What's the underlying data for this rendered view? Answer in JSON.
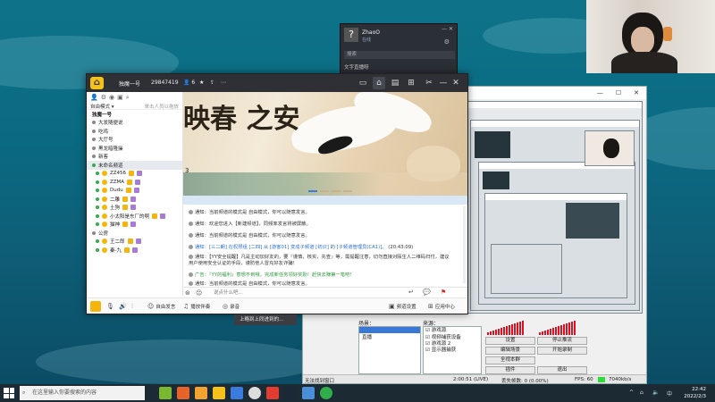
{
  "qq": {
    "avatar": "?",
    "name": "ZhaoO",
    "sub": "在线",
    "search": "搜索",
    "note": "文字直播呀"
  },
  "yy": {
    "channel_name": "独魔一号",
    "channel_id": "29847419",
    "online_count": "6",
    "mode": "自由模式",
    "mode_hint": "单击人员以拖放",
    "banner_text": "映春 之安",
    "banner_corner": "3",
    "sidebar": {
      "channels": [
        {
          "label": "独魔一号"
        },
        {
          "label": "大发随便说"
        },
        {
          "label": "吃鸡"
        },
        {
          "label": "大厅号"
        },
        {
          "label": "黑龙暗隆操"
        },
        {
          "label": "新客"
        },
        {
          "label": "未命名频道",
          "selected": true
        }
      ],
      "users": [
        "ZZ456",
        "ZZMA",
        "Dudu",
        "二雕",
        "土狗",
        "小太阳是东厂的啊",
        "猫神"
      ],
      "group2_label": "公房",
      "users2": [
        "王二郎",
        "秦-九"
      ]
    },
    "chat": [
      {
        "type": "plain",
        "text": "通知：当前频道的模式是 自由模式，你可以随意发言。"
      },
      {
        "type": "plain",
        "text": "通知：欢迎您进入【新建频道】，同频率发言将被屏蔽。"
      },
      {
        "type": "plain",
        "text": "通知：当前频道的模式是 自由模式，你可以随意发言。"
      },
      {
        "type": "blue",
        "sys": "通知：[三二朗] 在权限组 [二四] 从 [游客01] 变成子频道 [初识] 的 [子频道管理员(CA1)]。",
        "tail": "(20:43:09)"
      },
      {
        "type": "plain",
        "text": "通知：【YY安全提醒】凡是主动加好友的，要『谨慎，核实，先查』等，需提醒注意，切勿直接对陌生人二维码扫付，建议用户使用安全认证的手段，谨防他人冒充好友诈骗！"
      },
      {
        "type": "green",
        "text": "广告：『YY的福利』意想不到哦，完成新任务领好奖励！赶快去赚第一笔吧！"
      },
      {
        "type": "plain",
        "text": "通知：当前频道的模式是 自由模式，你可以随意发言。"
      }
    ],
    "input_placeholder": "说点什么吧...",
    "bottom": {
      "voice_label": "自由发言",
      "music_label": "播放伴奏",
      "record_label": "录音",
      "settings_label": "频道设置",
      "apps_label": "应用中心"
    },
    "tooltip": "上略到上同进到的..."
  },
  "obs": {
    "scenes_label": "场景：",
    "scenes": [
      "直播"
    ],
    "sources_label": "来源：",
    "sources": [
      {
        "label": "游戏源",
        "checked": true
      },
      {
        "label": "视频捕获设备",
        "checked": true
      },
      {
        "label": "游戏源 2",
        "checked": true
      },
      {
        "label": "显示器捕获",
        "checked": true
      }
    ],
    "buttons": {
      "settings": "设置",
      "stop_stream": "停止推流",
      "edit_scene": "编辑场景",
      "start_record": "开始录制",
      "fullscreen": "全视本群",
      "plugins": "插件",
      "exit": "退出"
    },
    "status": {
      "left": "无法找到窗口",
      "time": "2:00:51 (LIVE)",
      "dropped": "丢失帧数: 0 (0.00%)",
      "fps": "FPS: 60",
      "bitrate": "7040kb/s"
    }
  },
  "taskbar": {
    "search_placeholder": "在这里输入你要搜索的内容",
    "time": "22:42",
    "date": "2022/2/3",
    "lang": "中"
  }
}
